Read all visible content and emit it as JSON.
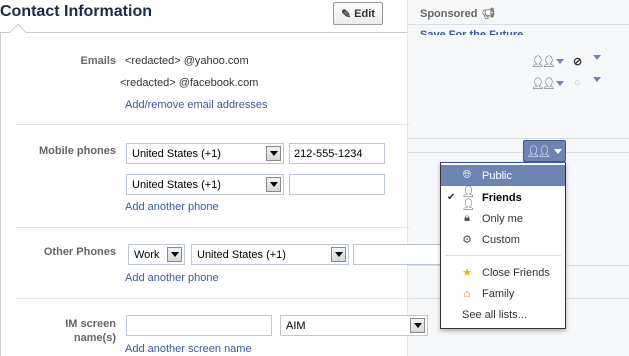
{
  "header": {
    "title": "Contact Information",
    "edit_label": "Edit",
    "edit_icon": "pencil-icon"
  },
  "sponsored": {
    "label": "Sponsored",
    "icon": "megaphone-icon",
    "ad_title": "Save For the Future"
  },
  "emails": {
    "label": "Emails",
    "items": [
      {
        "address": "<redacted> @yahoo.com",
        "audience_icon": "friends-icon",
        "state_icon": "hidden-circle-slash-icon"
      },
      {
        "address": "<redacted> @facebook.com",
        "audience_icon": "friends-icon",
        "state_icon": "empty-circle-icon"
      }
    ],
    "link": "Add/remove email addresses"
  },
  "mobile": {
    "label": "Mobile phones",
    "rows": [
      {
        "country": "United States (+1)",
        "number": "212-555-1234"
      },
      {
        "country": "United States (+1)",
        "number": ""
      }
    ],
    "link": "Add another phone"
  },
  "other_phones": {
    "label": "Other Phones",
    "type": "Work",
    "country": "United States (+1)",
    "link": "Add another phone"
  },
  "im": {
    "label_line1": "IM screen",
    "label_line2": "name(s)",
    "value": "",
    "service": "AIM",
    "link": "Add another screen name"
  },
  "audience_menu": {
    "button_icon": "friends-icon",
    "items": [
      {
        "label": "Public",
        "icon": "globe-icon",
        "state": "hovered"
      },
      {
        "label": "Friends",
        "icon": "friends-icon",
        "state": "selected"
      },
      {
        "label": "Only me",
        "icon": "lock-icon",
        "state": ""
      },
      {
        "label": "Custom",
        "icon": "gear-icon",
        "state": ""
      }
    ],
    "lists": [
      {
        "label": "Close Friends",
        "icon": "star-icon"
      },
      {
        "label": "Family",
        "icon": "home-icon"
      }
    ],
    "see_all": "See all lists..."
  },
  "colors": {
    "accent": "#3b5998",
    "menu_hover": "#6d84b4",
    "label_grey": "#666666"
  }
}
